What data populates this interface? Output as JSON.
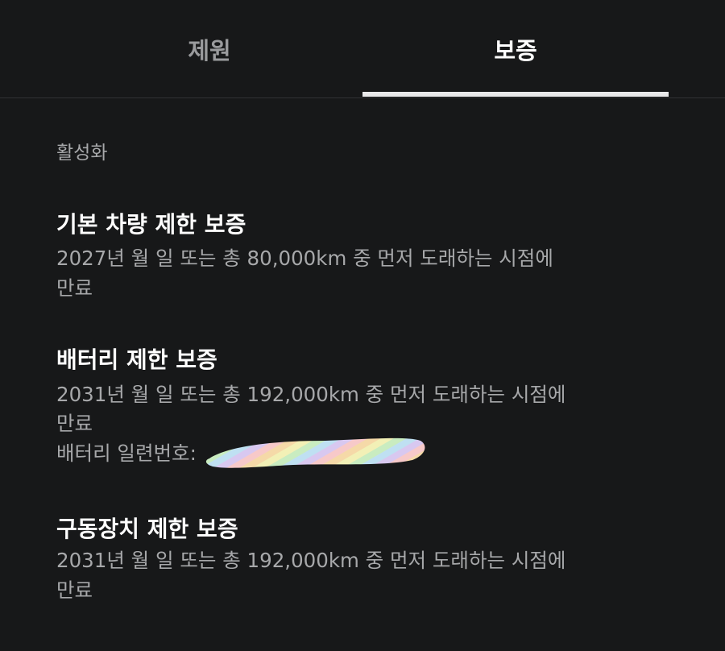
{
  "tabs": [
    {
      "label": "제원",
      "selected": false
    },
    {
      "label": "보증",
      "selected": true
    }
  ],
  "section": {
    "label": "활성화"
  },
  "warranties": [
    {
      "title": "기본 차량 제한 보증",
      "line1": "2027년   월      일 또는 총 80,000km 중 먼저 도래하는 시점에",
      "line2": "만료"
    },
    {
      "title": "배터리 제한 보증",
      "line1": "2031년   월      일 또는 총 192,000km 중 먼저 도래하는 시점에",
      "line2": "만료",
      "line3": "배터리 일련번호:"
    },
    {
      "title": "구동장치 제한 보증",
      "line1": "2031년   월      일 또는 총 192,000km 중 먼저 도래하는 시점에",
      "line2": "만료"
    }
  ],
  "colors": {
    "background": "#171819",
    "text_primary": "#ffffff",
    "text_secondary": "#a7a8aa",
    "tab_inactive": "#9a9b9d",
    "indicator": "#e9e9ea"
  }
}
